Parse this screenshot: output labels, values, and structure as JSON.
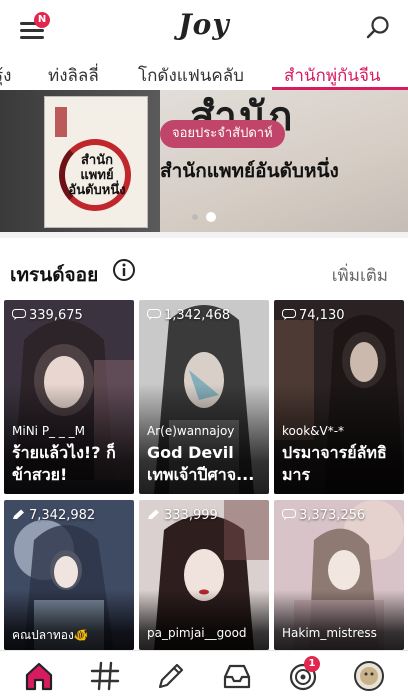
{
  "header": {
    "menu_badge": "N",
    "logo": "Joy"
  },
  "tabs": [
    {
      "label": "รุ้ง",
      "active": false
    },
    {
      "label": "ท่งลิลลี่",
      "active": false
    },
    {
      "label": "โกดังแฟนคลับ",
      "active": false
    },
    {
      "label": "สำนักพู่กันจีน",
      "active": true
    }
  ],
  "banner": {
    "pill": "จอยประจำสัปดาห์",
    "title": "สำนักแพทย์อันดับหนึ่ง",
    "brush_text": "สำนัก",
    "book_text": "สำนัก แพทย์ อันดับหนึ่ง",
    "slides": 2,
    "active_slide": 2
  },
  "section": {
    "title": "เทรนด์จอย",
    "more": "เพิ่มเติม"
  },
  "cards": [
    {
      "count": "339,675",
      "author": "MiNi P_ _ _M",
      "title": "ร้ายแล้วไง!? ก็ข้าสวย!",
      "count_icon": "joy-chat-icon",
      "palette": [
        "#3b3440",
        "#7a5e68",
        "#2a2024"
      ]
    },
    {
      "count": "1,342,468",
      "author": "Ar(e)wannajoy",
      "title": "God Devil เทพเจ้าปีศาจ...",
      "count_icon": "joy-chat-icon",
      "palette": [
        "#c9c9c9",
        "#6f6f6f",
        "#3a3a3a"
      ]
    },
    {
      "count": "74,130",
      "author": "kook&V*-*",
      "title": "ปรมาจารย์ลัทธิมาร",
      "count_icon": "joy-chat-icon",
      "palette": [
        "#2b2323",
        "#4d3a34",
        "#1a1414"
      ]
    },
    {
      "count": "7,342,982",
      "author": "คณปลาทอง🐠",
      "title": "",
      "count_icon": "pencil-icon",
      "palette": [
        "#3f4a63",
        "#b8c2d6",
        "#2c3347"
      ]
    },
    {
      "count": "333,999",
      "author": "pa_pimjai__good",
      "title": "",
      "count_icon": "pencil-icon",
      "palette": [
        "#d9d0cf",
        "#7a4e4e",
        "#2e1e1e"
      ]
    },
    {
      "count": "3,373,256",
      "author": "Hakim_mistress",
      "title": "",
      "count_icon": "joy-chat-icon",
      "palette": [
        "#d7c3c8",
        "#e8d6cf",
        "#8e7a72"
      ]
    }
  ],
  "bottom_nav": [
    {
      "icon": "home-icon",
      "active": true
    },
    {
      "icon": "hashtag-icon",
      "active": false
    },
    {
      "icon": "pencil-icon",
      "active": false
    },
    {
      "icon": "inbox-tray-icon",
      "active": false
    },
    {
      "icon": "target-icon",
      "active": false,
      "badge": "1"
    },
    {
      "icon": "profile-avatar-icon",
      "active": false
    }
  ],
  "colors": {
    "accent": "#d81b60",
    "badge": "#e2264d",
    "pill": "#c1456b"
  }
}
